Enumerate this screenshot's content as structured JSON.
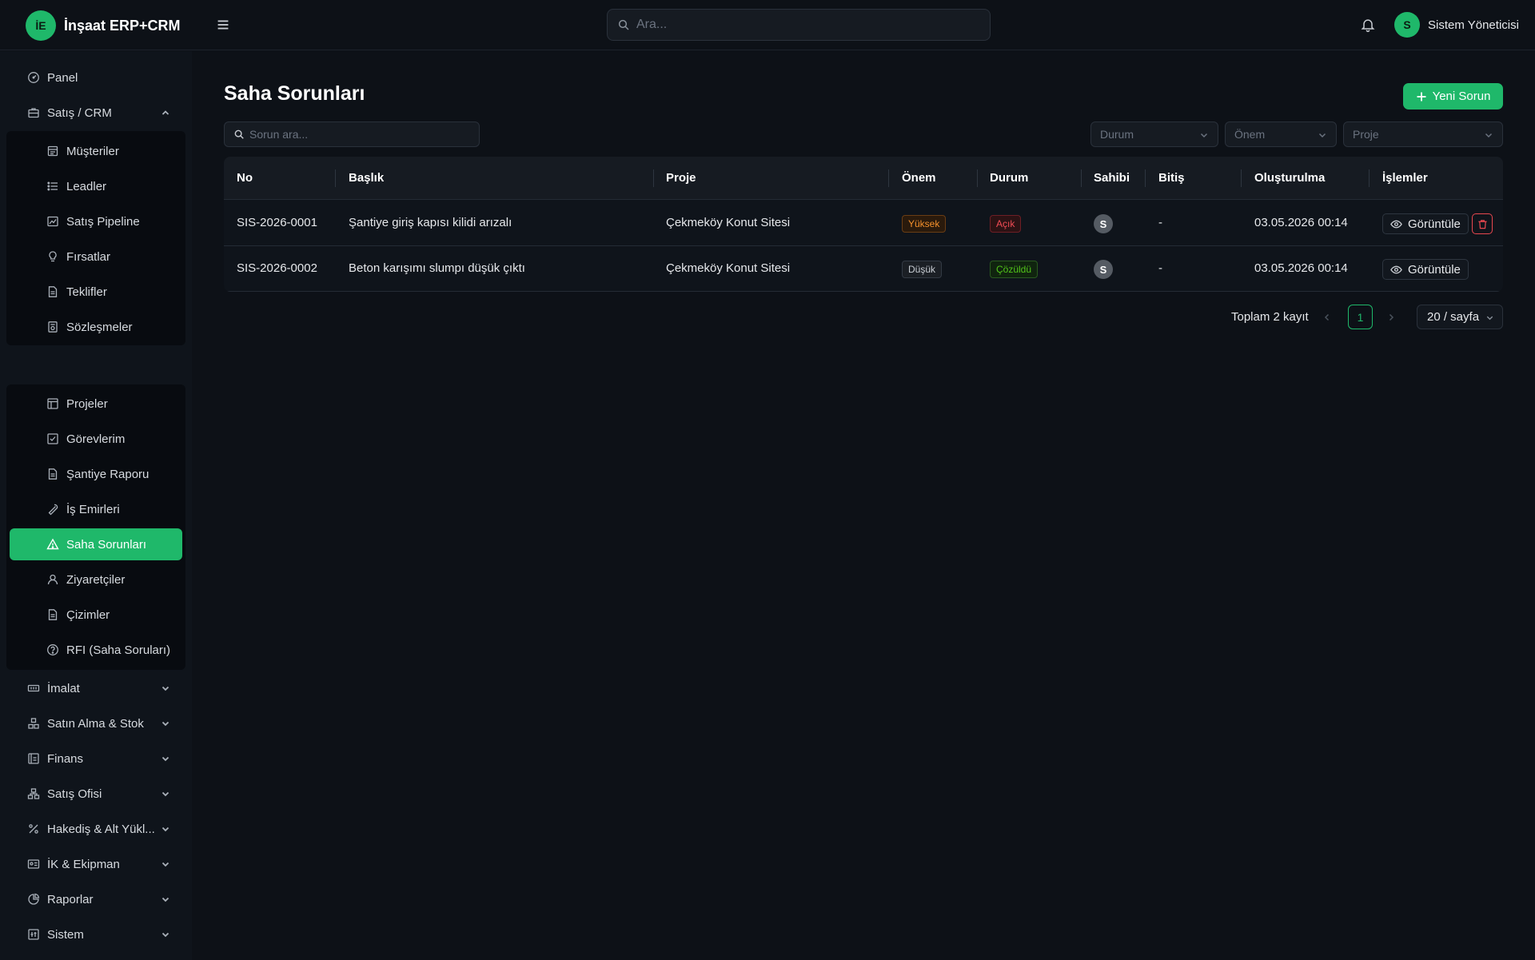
{
  "app": {
    "brand_initials": "İE",
    "brand_name": "İnşaat ERP+CRM"
  },
  "header": {
    "search_placeholder": "Ara...",
    "user_initial": "S",
    "user_name": "Sistem Yöneticisi"
  },
  "sidebar": {
    "panel": "Panel",
    "sales_group": "Satış / CRM",
    "sales_items": [
      "Müşteriler",
      "Leadler",
      "Satış Pipeline",
      "Fırsatlar",
      "Teklifler",
      "Sözleşmeler"
    ],
    "project_items": [
      "Projeler",
      "Görevlerim",
      "Şantiye Raporu",
      "İş Emirleri",
      "Saha Sorunları",
      "Ziyaretçiler",
      "Çizimler",
      "RFI (Saha Soruları)"
    ],
    "active_item": "Saha Sorunları",
    "groups": [
      "İmalat",
      "Satın Alma & Stok",
      "Finans",
      "Satış Ofisi",
      "Hakediş & Alt Yükl...",
      "İK & Ekipman",
      "Raporlar",
      "Sistem"
    ]
  },
  "main": {
    "title": "Saha Sorunları",
    "new_button": "Yeni Sorun",
    "search_placeholder": "Sorun ara...",
    "filters": {
      "status": "Durum",
      "priority": "Önem",
      "project": "Proje"
    },
    "columns": [
      "No",
      "Başlık",
      "Proje",
      "Önem",
      "Durum",
      "Sahibi",
      "Bitiş",
      "Oluşturulma",
      "İşlemler"
    ],
    "rows": [
      {
        "no": "SIS-2026-0001",
        "title": "Şantiye giriş kapısı kilidi arızalı",
        "project": "Çekmeköy Konut Sitesi",
        "priority": "Yüksek",
        "status": "Açık",
        "owner": "S",
        "due": "-",
        "created": "03.05.2026 00:14",
        "view": "Görüntüle"
      },
      {
        "no": "SIS-2026-0002",
        "title": "Beton karışımı slumpı düşük çıktı",
        "project": "Çekmeköy Konut Sitesi",
        "priority": "Düşük",
        "status": "Çözüldü",
        "owner": "S",
        "due": "-",
        "created": "03.05.2026 00:14",
        "view": "Görüntüle"
      }
    ],
    "pagination": {
      "total": "Toplam 2 kayıt",
      "current_page": "1",
      "page_size": "20 / sayfa"
    }
  },
  "colors": {
    "accent": "#1fb86a",
    "background": "#0d1117",
    "danger": "#e8474f"
  }
}
